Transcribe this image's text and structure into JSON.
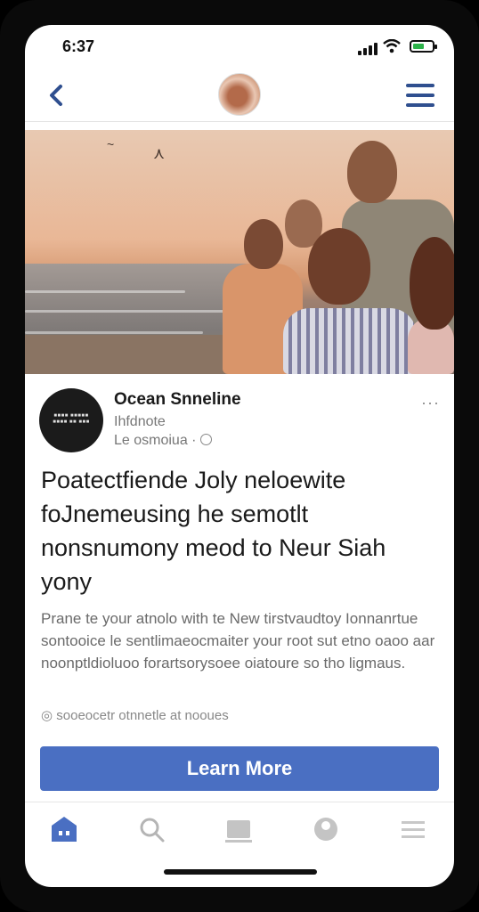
{
  "status": {
    "time": "6:37",
    "battery_percent": 60,
    "battery_color": "#2db34a"
  },
  "nav": {
    "back_icon": "chevron-left-icon",
    "menu_icon": "hamburger-icon"
  },
  "post": {
    "page_name": "Ocean Snneline",
    "page_category": "Ihfdnote",
    "page_meta": "Le osmoiua ·",
    "more_label": "···",
    "headline": "Poatectfiende Joly neloewite foJnemeusing he semotlt nonsnumony meod to Neur Siah yony",
    "body": "Prane te your atnolo with te New tirstvaudtoy Ionnanrtue sontooice le sentlimaeocmaiter your root sut etno oaoo aar noonptldioluoo forartsorysoee oiatoure so tho ligmaus.",
    "caption": "sooeocetr otnnetle at nooues",
    "cta_label": "Learn More",
    "cta_color": "#4a6fc2"
  },
  "tabbar": {
    "tabs": [
      {
        "name": "home",
        "icon": "home-icon",
        "active": true
      },
      {
        "name": "search",
        "icon": "search-icon",
        "active": false
      },
      {
        "name": "media",
        "icon": "media-icon",
        "active": false
      },
      {
        "name": "profile",
        "icon": "profile-icon",
        "active": false
      },
      {
        "name": "menu",
        "icon": "menu-icon",
        "active": false
      }
    ]
  }
}
